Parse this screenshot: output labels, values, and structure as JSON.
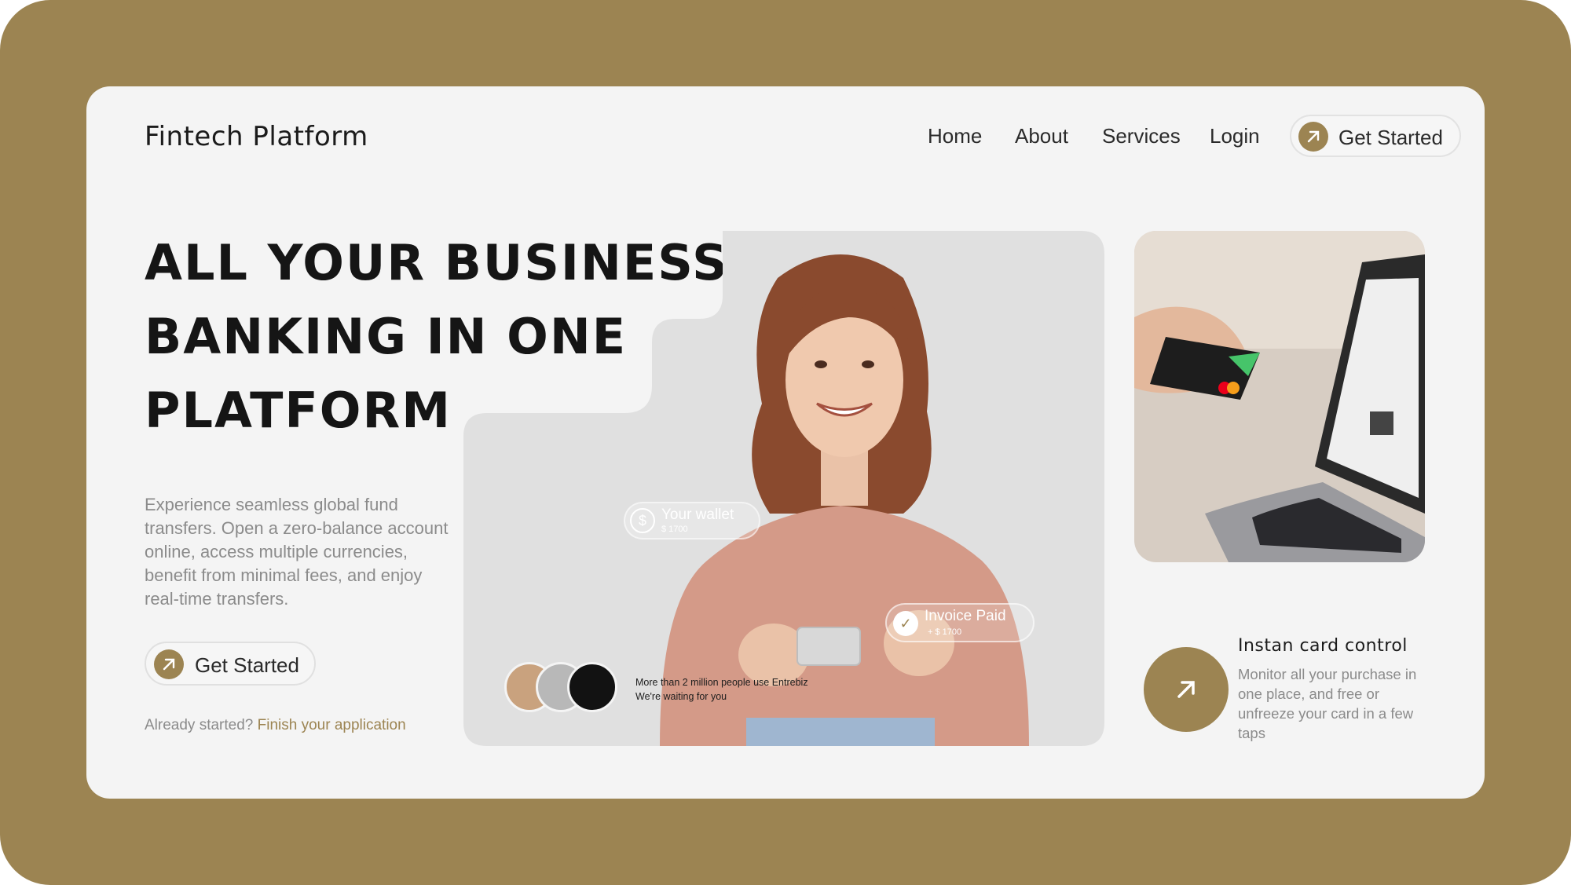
{
  "colors": {
    "accent": "#9c8452",
    "page_bg": "#f4f4f4",
    "text_dark": "#151515",
    "text_muted": "#8b8b8b"
  },
  "header": {
    "brand": "Fintech Platform",
    "nav": [
      "Home",
      "About",
      "Services",
      "Login"
    ],
    "cta_label": "Get Started",
    "cta_icon": "arrow-up-right-icon"
  },
  "hero": {
    "title": "ALL YOUR BUSINESS BANKING IN ONE PLATFORM",
    "description": "Experience seamless global fund transfers. Open a zero-balance account online, access multiple currencies, benefit from minimal fees, and enjoy real-time transfers.",
    "cta_label": "Get Started",
    "already_text": "Already started?",
    "already_link": "Finish your application"
  },
  "overlays": {
    "wallet": {
      "title": "Your wallet",
      "amount": "$ 1700",
      "icon": "dollar-icon"
    },
    "invoice": {
      "title": "Invoice Paid",
      "amount": "+ $ 1700",
      "icon": "check-icon"
    },
    "users_line1": "More than 2 million people use Entrebiz",
    "users_line2": "We're waiting for you"
  },
  "feature": {
    "title": "Instan card control",
    "description": "Monitor all your purchase in one place, and free or unfreeze your card in a few taps",
    "icon": "arrow-up-right-icon"
  }
}
